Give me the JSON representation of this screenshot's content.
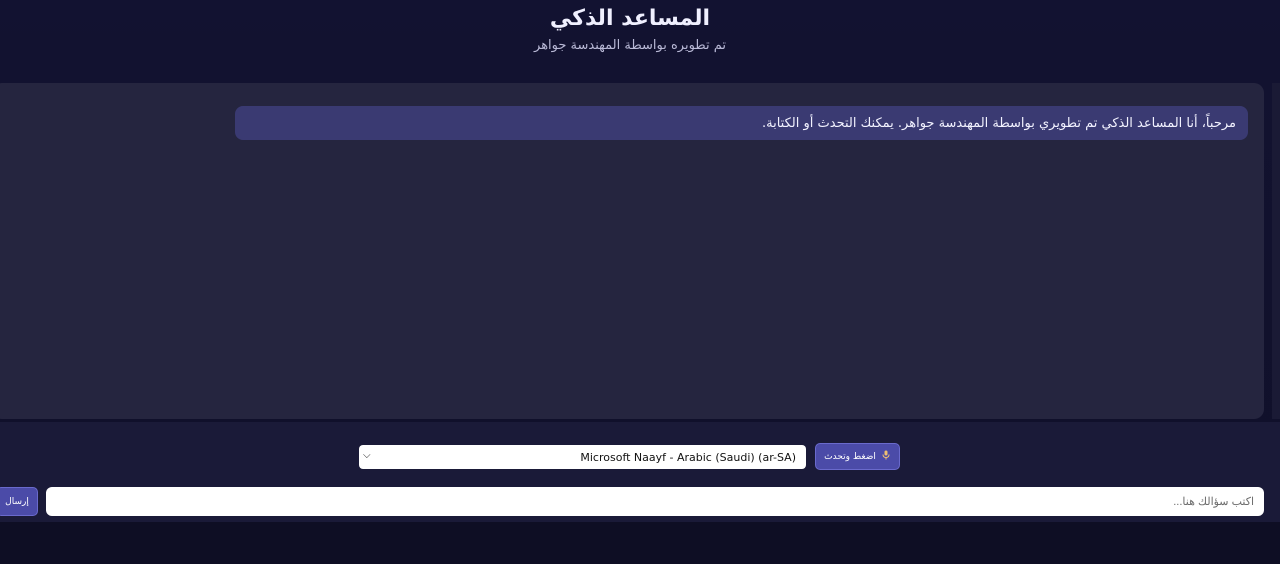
{
  "header": {
    "title": "المساعد الذكي",
    "subtitle": "تم تطويره بواسطة المهندسة جواهر"
  },
  "chat": {
    "messages": [
      {
        "sender": "bot",
        "text": "مرحباً، أنا المساعد الذكي تم تطويري بواسطة المهندسة جواهر. يمكنك التحدث أو الكتابة."
      }
    ]
  },
  "controls": {
    "voice_button_label": "اضغط وتحدث",
    "voice_button_icon": "microphone-icon",
    "voice_select_value": "Microsoft Naayf - Arabic (Saudi) (ar-SA)"
  },
  "input": {
    "placeholder": "اكتب سؤالك هنا...",
    "send_label": "إرسال"
  },
  "colors": {
    "background": "#121231",
    "panel": "#25253f",
    "bubble": "#3a3a72",
    "button": "#4b4ba8"
  }
}
